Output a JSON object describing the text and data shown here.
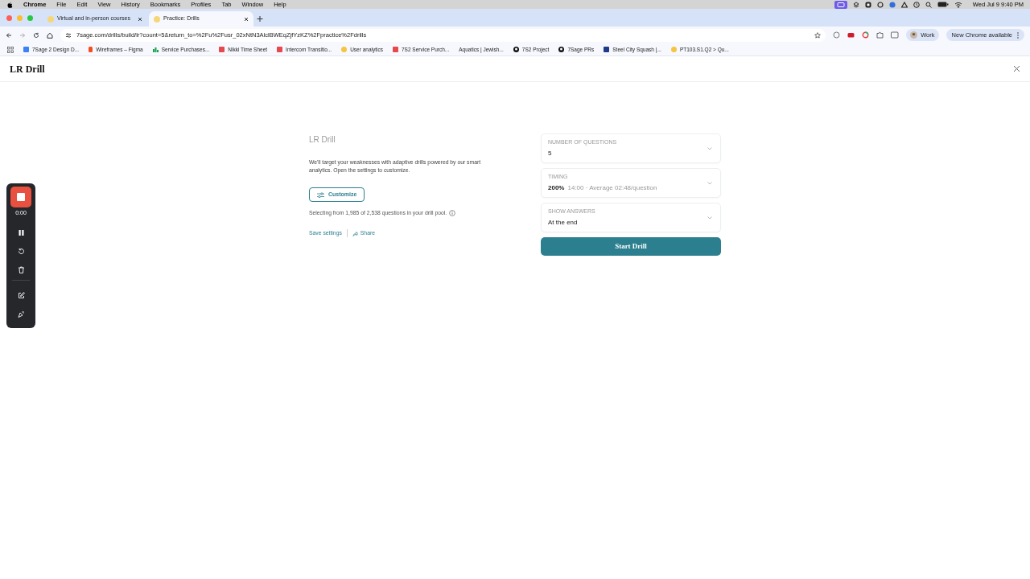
{
  "menu_bar": {
    "app": "Chrome",
    "items": [
      "File",
      "Edit",
      "View",
      "History",
      "Bookmarks",
      "Profiles",
      "Tab",
      "Window",
      "Help"
    ],
    "clock": "Wed Jul 9  9:40 PM"
  },
  "tabs": [
    {
      "title": "Virtual and in-person courses",
      "selected": false
    },
    {
      "title": "Practice: Drills",
      "selected": true
    }
  ],
  "address": "7sage.com/drills/build/lr?count=5&return_to=%2Fu%2Fusr_02xNtN3AlclBWEqZjfYzKZ%2Fpractice%2Fdrills",
  "profile": "Work",
  "update_button": "New Chrome available",
  "bookmarks": [
    {
      "label": "7Sage 2 Design D...",
      "kind": "square",
      "color": "#3b82f6"
    },
    {
      "label": "Wireframes – Figma",
      "kind": "figma",
      "color": "#f24e1e"
    },
    {
      "label": "Service Purchases...",
      "kind": "chart",
      "color": "#16a34a"
    },
    {
      "label": "Nikki Time Sheet",
      "kind": "square",
      "color": "#e5484d"
    },
    {
      "label": "Intercom Transitio...",
      "kind": "square",
      "color": "#e5484d"
    },
    {
      "label": "User analytics",
      "kind": "badge",
      "color": "#f5c542"
    },
    {
      "label": "7S2 Service Purch...",
      "kind": "square",
      "color": "#e5484d"
    },
    {
      "label": "Aquatics | Jewish...",
      "kind": "none"
    },
    {
      "label": "7S2 Project",
      "kind": "github",
      "color": "#111111"
    },
    {
      "label": "7Sage PRs",
      "kind": "github",
      "color": "#111111"
    },
    {
      "label": "Steel City Squash |...",
      "kind": "square",
      "color": "#1e3a8a"
    },
    {
      "label": "PT103.S1.Q2 > Qu...",
      "kind": "badge",
      "color": "#f5c542"
    }
  ],
  "page": {
    "title": "LR Drill",
    "heading": "LR Drill",
    "description": "We'll target your weaknesses with adaptive drills powered by our smart analytics. Open the settings to customize.",
    "customize": "Customize",
    "pool": "Selecting from 1,985 of 2,538 questions in your drill pool.",
    "save": "Save settings",
    "share": "Share",
    "settings": [
      {
        "label": "NUMBER OF QUESTIONS",
        "value": "5"
      },
      {
        "label": "TIMING",
        "value": "200%",
        "detail": "14:00 · Average 02:48/question"
      },
      {
        "label": "SHOW ANSWERS",
        "value": "At the end"
      }
    ],
    "start": "Start Drill"
  },
  "recorder": {
    "time": "0:00"
  }
}
